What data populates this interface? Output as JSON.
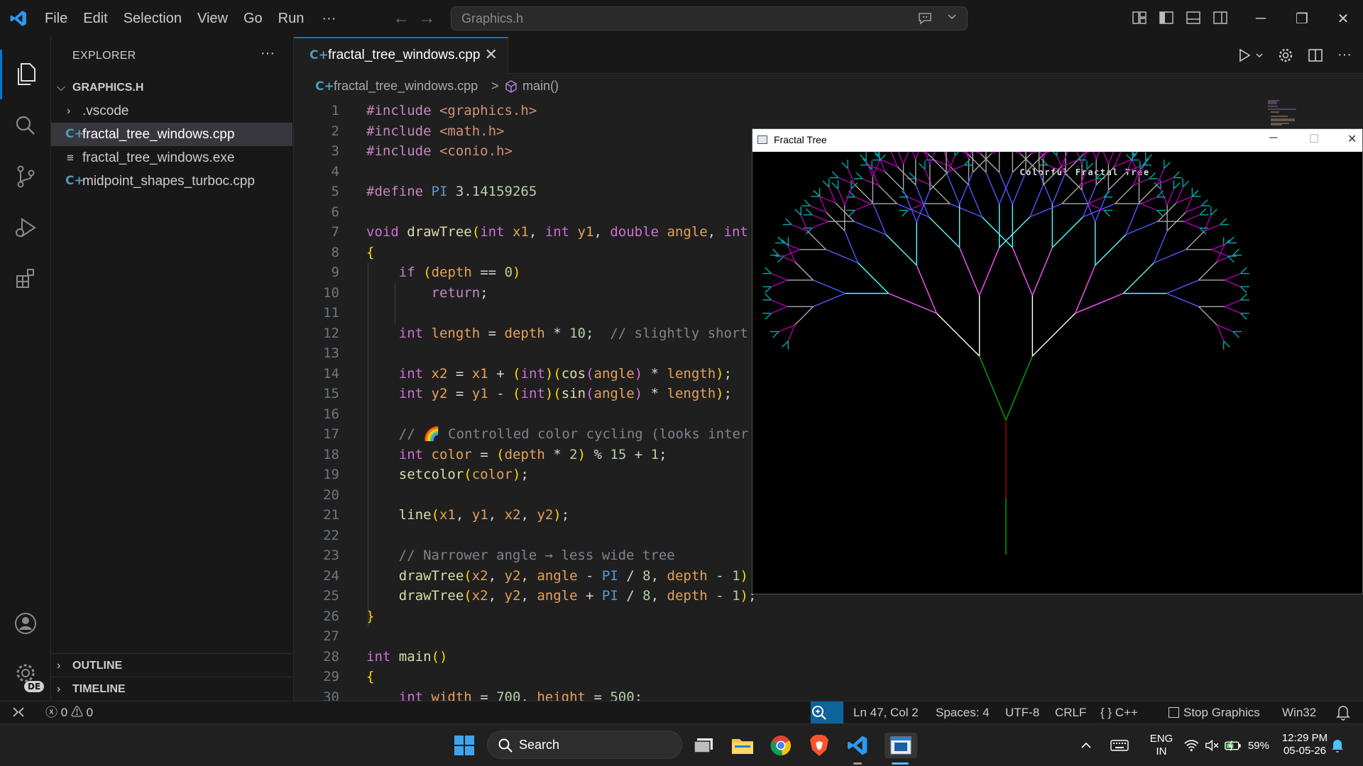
{
  "menu": [
    "File",
    "Edit",
    "Selection",
    "View",
    "Go",
    "Run"
  ],
  "menu_more": "···",
  "command_center": {
    "text": "Graphics.h"
  },
  "window_controls": {
    "minimize": "─",
    "restore": "❐",
    "close": "✕"
  },
  "sidebar": {
    "title": "EXPLORER",
    "folder": "GRAPHICS.H",
    "items": [
      {
        "label": ".vscode",
        "kind": "folder"
      },
      {
        "label": "fractal_tree_windows.cpp",
        "kind": "cpp",
        "selected": true
      },
      {
        "label": "fractal_tree_windows.exe",
        "kind": "exe"
      },
      {
        "label": "midpoint_shapes_turboc.cpp",
        "kind": "cpp"
      }
    ],
    "outline": "OUTLINE",
    "timeline": "TIMELINE",
    "account_badge": "DE"
  },
  "tab": {
    "label": "fractal_tree_windows.cpp",
    "close": "✕"
  },
  "breadcrumb": {
    "file": "fractal_tree_windows.cpp",
    "separator": ">",
    "symbol": "main()"
  },
  "code_lines": [
    "#include <graphics.h>",
    "#include <math.h>",
    "#include <conio.h>",
    "",
    "#define PI 3.14159265",
    "",
    "void drawTree(int x1, int y1, double angle, int",
    "{",
    "    if (depth == 0)",
    "        return;",
    "",
    "    int length = depth * 10;  // slightly short",
    "",
    "    int x2 = x1 + (int)(cos(angle) * length);",
    "    int y2 = y1 - (int)(sin(angle) * length);",
    "",
    "    // 🌈 Controlled color cycling (looks inter",
    "    int color = (depth * 2) % 15 + 1;",
    "    setcolor(color);",
    "",
    "    line(x1, y1, x2, y2);",
    "",
    "    // Narrower angle → less wide tree",
    "    drawTree(x2, y2, angle - PI / 8, depth - 1)",
    "    drawTree(x2, y2, angle + PI / 8, depth - 1);",
    "}",
    "",
    "int main()",
    "{",
    "    int width = 700, height = 500;"
  ],
  "fractal_window": {
    "title": "Fractal Tree",
    "canvas_caption": "Colorful Fractal Tree",
    "controls": {
      "minimize": "─",
      "maximize": "☐",
      "close": "✕"
    }
  },
  "statusbar": {
    "errors": "0",
    "warnings": "0",
    "position": "Ln 47, Col 2",
    "spaces": "Spaces: 4",
    "encoding": "UTF-8",
    "eol": "CRLF",
    "language": "C++",
    "stop_graphics": "Stop Graphics",
    "platform": "Win32"
  },
  "taskbar": {
    "search": "Search",
    "lang_top": "ENG",
    "lang_bottom": "IN",
    "battery": "59%",
    "time": "12:29 PM",
    "date": "05-05-26"
  },
  "colors": {
    "accent": "#0078d4",
    "editor_bg": "#1f1f1f",
    "chrome_bg": "#181818",
    "keyword": "#c586c0",
    "function": "#dcdcaa",
    "variable": "#e6a15a"
  }
}
